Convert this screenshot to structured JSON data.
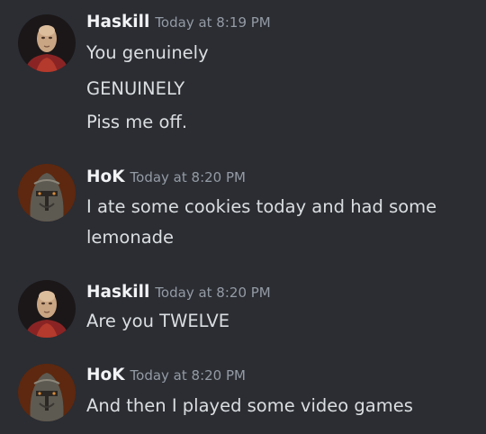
{
  "messages": [
    {
      "author": "Haskill",
      "time": "Today at 8:19 PM",
      "avatar": "bald-man-avatar",
      "lines": [
        "You genuinely",
        "GENUINELY",
        "Piss me off."
      ]
    },
    {
      "author": "HoK",
      "time": "Today at 8:20 PM",
      "avatar": "helmet-knight-avatar",
      "lines": [
        "I ate some cookies today and had some",
        "lemonade"
      ]
    },
    {
      "author": "Haskill",
      "time": "Today at 8:20 PM",
      "avatar": "bald-man-avatar",
      "lines": [
        "Are you TWELVE"
      ]
    },
    {
      "author": "HoK",
      "time": "Today at 8:20 PM",
      "avatar": "helmet-knight-avatar",
      "lines": [
        "And then I played some video games"
      ]
    }
  ],
  "colors": {
    "background": "#2b2d33",
    "username": "#f2f3f5",
    "timestamp": "#949ba4",
    "message": "#dbdee1"
  }
}
